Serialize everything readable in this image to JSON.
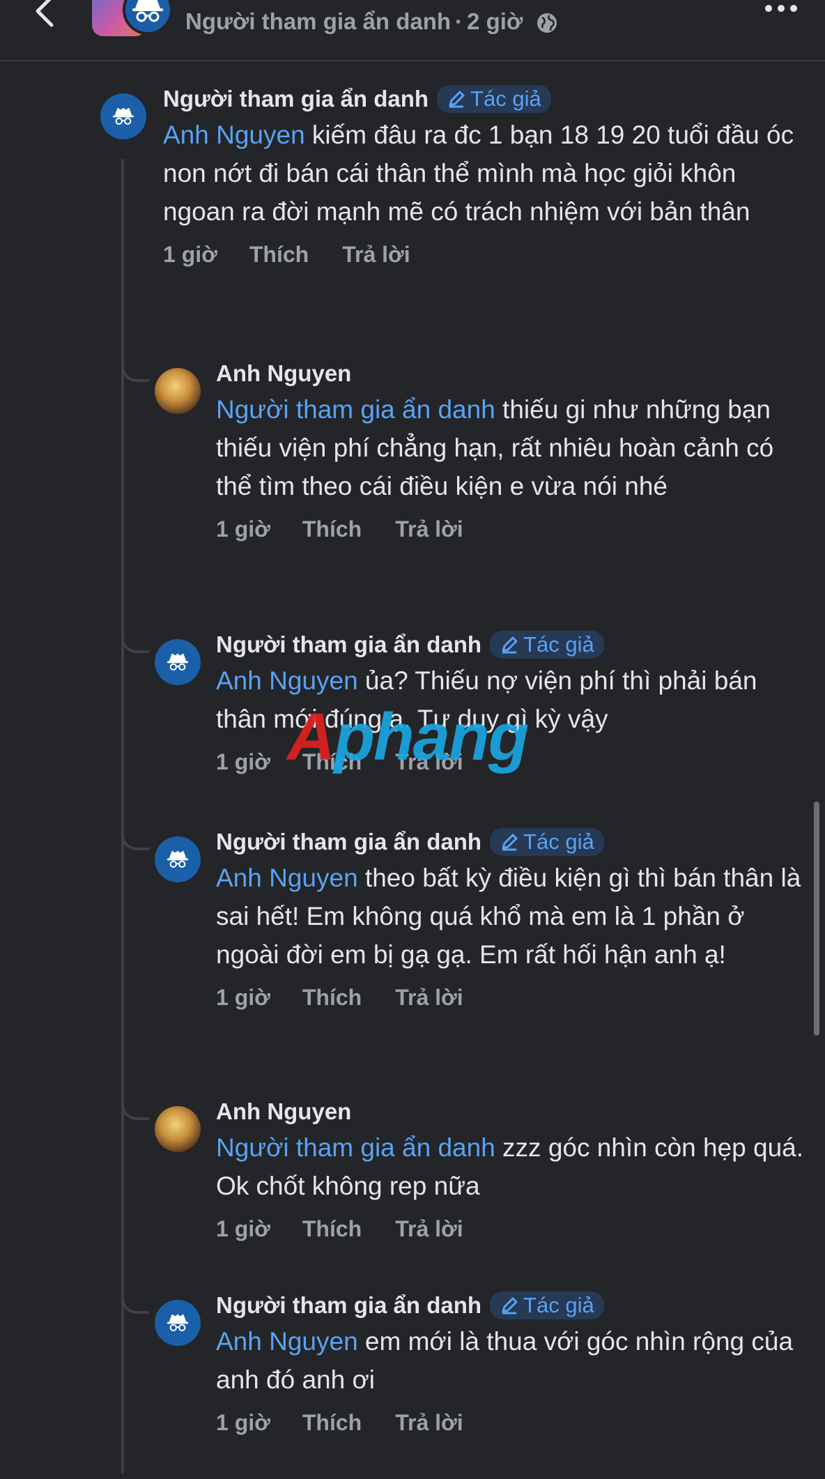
{
  "header": {
    "author": "Người tham gia ẩn danh",
    "separator": "·",
    "time": "2 giờ",
    "privacy_icon": "globe-icon",
    "back_icon": "chevron-left-icon",
    "more_icon": "more-horizontal-icon"
  },
  "author_badge": "Tác giả",
  "actions": {
    "like": "Thích",
    "reply": "Trả lời"
  },
  "watermark": {
    "part1": "A",
    "part2": "phang"
  },
  "colors": {
    "background": "#232528",
    "mention": "#5aa2f5",
    "badge_bg": "#263a55",
    "anon_avatar": "#1c5fa9"
  },
  "comments": [
    {
      "name": "Người tham gia ẩn danh",
      "is_author": true,
      "avatar": "incognito-icon",
      "mention": "Anh Nguyen",
      "text": " kiếm đâu ra đc 1 bạn 18 19 20 tuổi đầu óc non nớt đi bán cái thân thể mình mà học giỏi khôn ngoan ra đời mạnh mẽ có trách nhiệm với bản thân",
      "time": "1 giờ"
    },
    {
      "name": "Anh Nguyen",
      "is_author": false,
      "avatar": "profile-photo",
      "mention": "Người tham gia ẩn danh",
      "text": "  thiếu gi như những bạn thiếu viện phí chẳng hạn, rất nhiêu hoàn cảnh có thể tìm theo cái điều kiện e vừa nói nhé",
      "time": "1 giờ"
    },
    {
      "name": "Người tham gia ẩn danh",
      "is_author": true,
      "avatar": "incognito-icon",
      "mention": "Anh Nguyen",
      "text": " ủa? Thiếu nợ viện phí thì phải bán thân mới đúng ạ. Tư duy gì kỳ vậy",
      "time": "1 giờ"
    },
    {
      "name": "Người tham gia ẩn danh",
      "is_author": true,
      "avatar": "incognito-icon",
      "mention": "Anh Nguyen",
      "text": " theo bất kỳ điều kiện gì thì bán thân là sai hết! Em không quá khổ mà em là 1 phần ở ngoài đời em bị gạ gạ. Em rất hối hận anh ạ!",
      "time": "1 giờ"
    },
    {
      "name": "Anh Nguyen",
      "is_author": false,
      "avatar": "profile-photo",
      "mention": "Người tham gia ẩn danh",
      "text": " zzz góc nhìn còn hẹp quá. Ok chốt không rep nữa",
      "time": "1 giờ"
    },
    {
      "name": "Người tham gia ẩn danh",
      "is_author": true,
      "avatar": "incognito-icon",
      "mention": "Anh Nguyen",
      "text": " em mới là thua với góc nhìn rộng của anh đó anh ơi",
      "time": "1 giờ"
    }
  ]
}
